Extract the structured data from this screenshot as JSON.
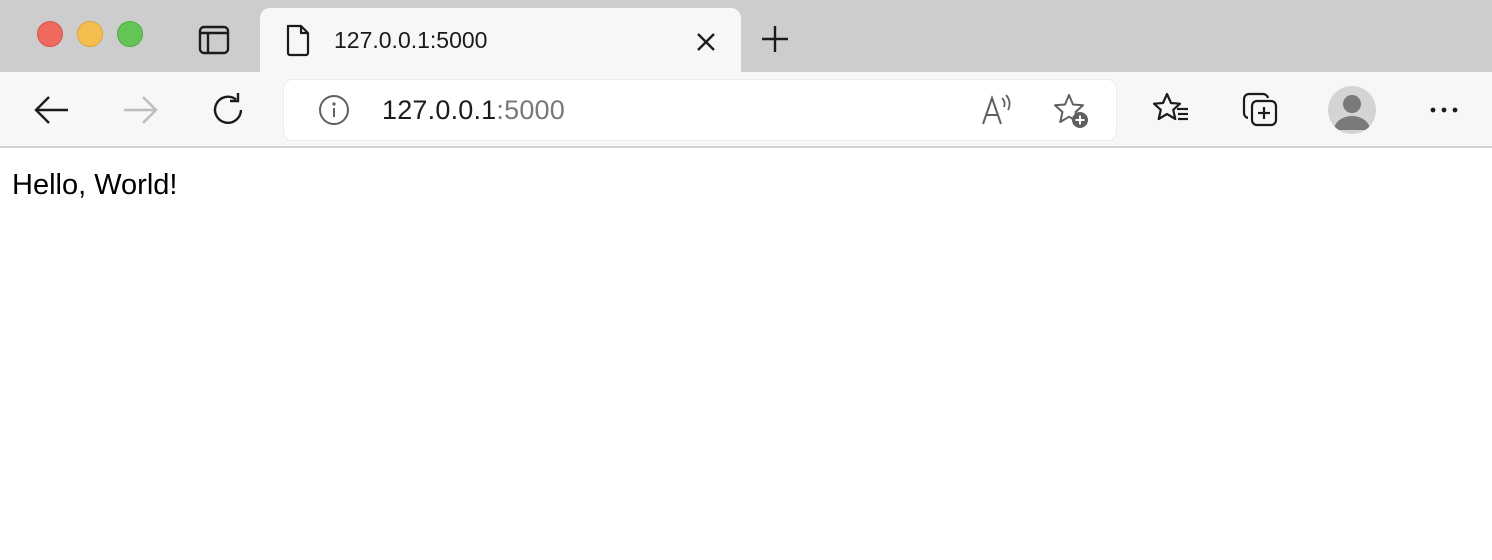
{
  "window": {
    "traffic_lights": {
      "close_color": "#ee6a5f",
      "minimize_color": "#f5be4f",
      "maximize_color": "#62c554"
    }
  },
  "tabs": [
    {
      "title": "127.0.0.1:5000",
      "active": true,
      "favicon": "document-icon"
    }
  ],
  "toolbar": {
    "back": "back-arrow-icon",
    "forward": "forward-arrow-icon",
    "reload": "reload-icon",
    "address": {
      "host": "127.0.0.1",
      "port": ":5000"
    },
    "favorites": "favorites-icon",
    "collections": "collections-icon",
    "more": "more-icon"
  },
  "page": {
    "body_text": "Hello, World!"
  }
}
